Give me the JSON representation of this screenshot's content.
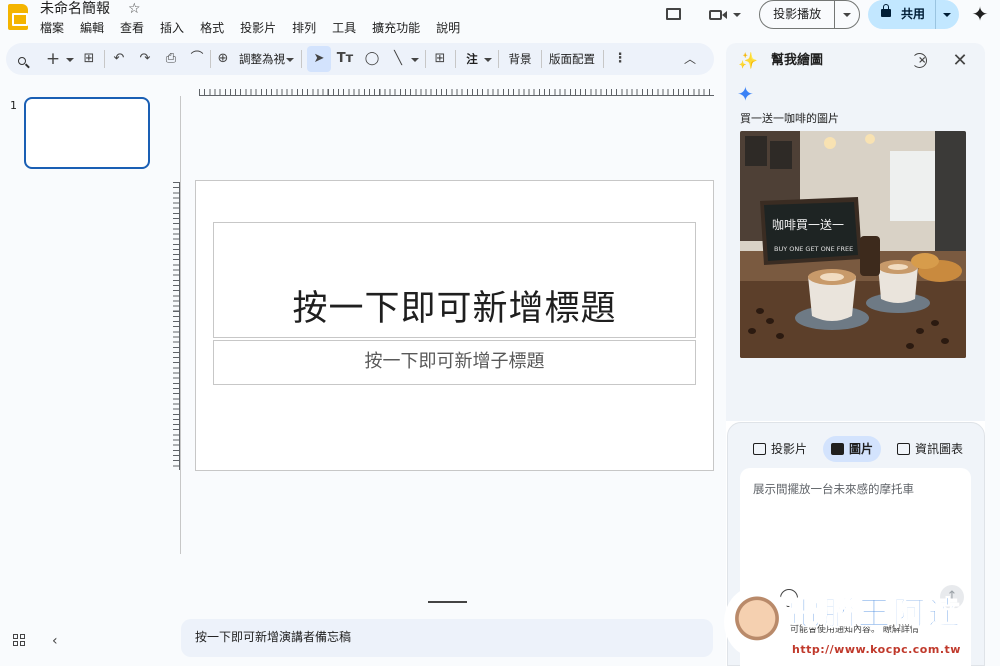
{
  "header": {
    "doc_title": "未命名簡報",
    "menu": [
      "檔案",
      "編輯",
      "查看",
      "插入",
      "格式",
      "投影片",
      "排列",
      "工具",
      "擴充功能",
      "說明"
    ],
    "present_label": "投影播放",
    "share_label": "共用"
  },
  "toolbar": {
    "zoom_label": "調整為視",
    "annotate_label": "注",
    "background_label": "背景",
    "layout_label": "版面配置"
  },
  "filmstrip": {
    "slide_number": "1"
  },
  "slide": {
    "title_placeholder": "按一下即可新增標題",
    "subtitle_placeholder": "按一下即可新增子標題"
  },
  "notes": {
    "placeholder": "按一下即可新增演講者備忘稿"
  },
  "side_panel": {
    "title": "幫我繪圖",
    "image_caption": "買一送一咖啡的圖片",
    "image_sign_text_1": "咖啡買一送一",
    "image_sign_text_2": "BUY ONE GET ONE FREE",
    "tabs": [
      {
        "label": "投影片",
        "active": false
      },
      {
        "label": "圖片",
        "active": true
      },
      {
        "label": "資訊圖表",
        "active": false
      }
    ],
    "prompt_placeholder": "展示間擺放一台未來感的摩托車",
    "disclaimer": "可能會使用通知內容。 瞭解詳情"
  },
  "watermark": {
    "text": "電腦王阿達",
    "url": "http://www.kocpc.com.tw"
  },
  "colors": {
    "accent": "#1a5fb4",
    "share_bg": "#c2e7ff",
    "toolbar_bg": "#edf2fa",
    "active_tab": "#d3e3fd"
  }
}
